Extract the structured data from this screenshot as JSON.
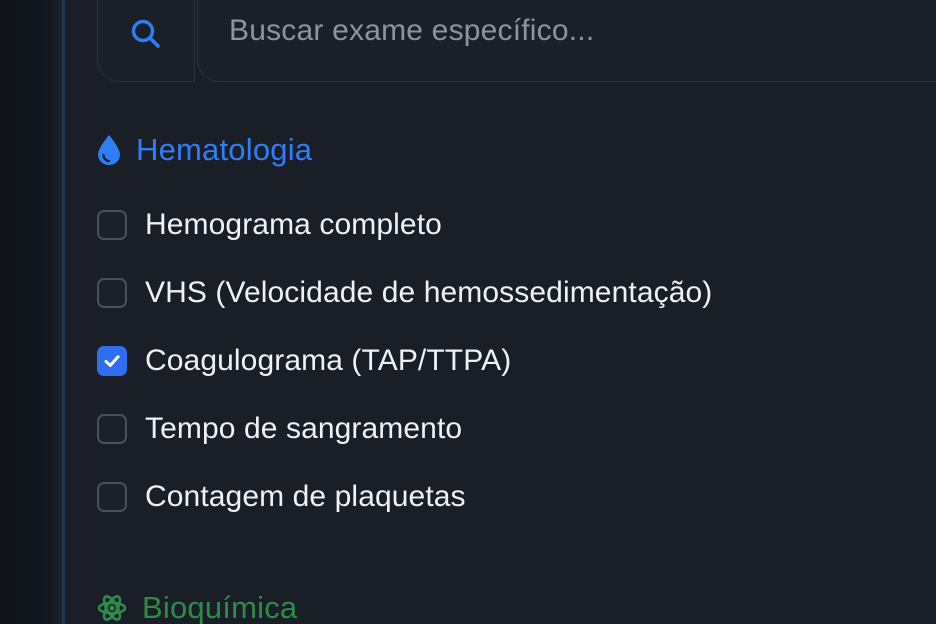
{
  "search": {
    "icon": "search-icon",
    "placeholder": "Buscar exame específico..."
  },
  "sections": [
    {
      "title": "Hematologia",
      "icon": "droplet-icon",
      "color": "#2f7ef5",
      "items": [
        {
          "label": "Hemograma completo",
          "checked": false
        },
        {
          "label": "VHS (Velocidade de hemossedimentação)",
          "checked": false
        },
        {
          "label": "Coagulograma (TAP/TTPA)",
          "checked": true
        },
        {
          "label": "Tempo de sangramento",
          "checked": false
        },
        {
          "label": "Contagem de plaquetas",
          "checked": false
        }
      ]
    },
    {
      "title": "Bioquímica",
      "icon": "atom-icon",
      "color": "#2e8b4a",
      "items": []
    }
  ],
  "colors": {
    "accent": "#2f6ef0",
    "background": "#1a1f27"
  }
}
